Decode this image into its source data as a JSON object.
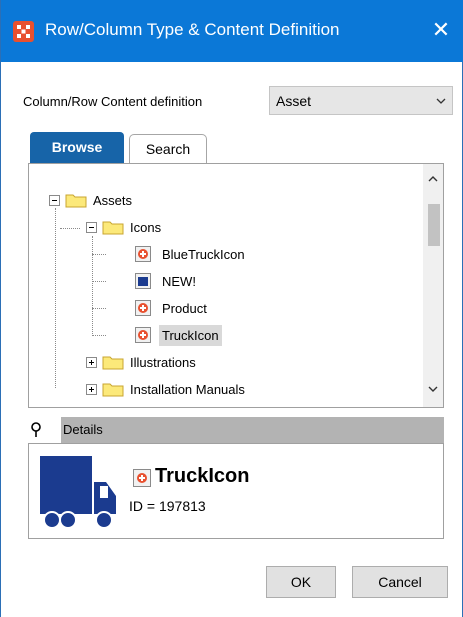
{
  "window": {
    "title": "Row/Column Type & Content Definition",
    "close_glyph": "✕"
  },
  "content_definition": {
    "label": "Column/Row Content definition",
    "value": "Asset"
  },
  "tabs": [
    {
      "label": "Browse",
      "active": true
    },
    {
      "label": "Search",
      "active": false
    }
  ],
  "tree": {
    "items": [
      {
        "label": "Assets",
        "type": "folder",
        "expanded": true
      },
      {
        "label": "Icons",
        "type": "folder",
        "expanded": true
      },
      {
        "label": "BlueTruckIcon",
        "type": "asset"
      },
      {
        "label": "NEW!",
        "type": "asset-blue"
      },
      {
        "label": "Product",
        "type": "asset"
      },
      {
        "label": "TruckIcon",
        "type": "asset",
        "selected": true
      },
      {
        "label": "Illustrations",
        "type": "folder",
        "expanded": false
      },
      {
        "label": "Installation Manuals",
        "type": "folder",
        "expanded": false
      }
    ]
  },
  "details": {
    "header": "Details",
    "name": "TruckIcon",
    "id_text": "ID = 197813"
  },
  "buttons": {
    "ok": "OK",
    "cancel": "Cancel"
  },
  "colors": {
    "titlebar": "#0b78d7",
    "tab_active": "#1764a8",
    "truck": "#1b3b8f",
    "asset_badge": "#e8502f"
  }
}
